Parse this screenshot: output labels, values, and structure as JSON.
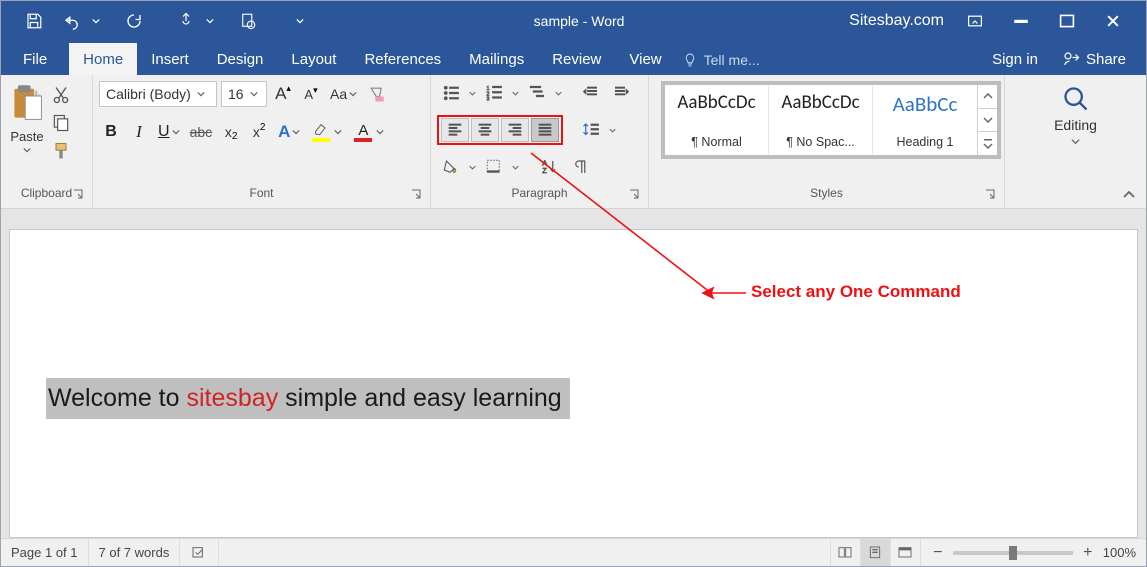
{
  "title": "sample - Word",
  "site": "Sitesbay.com",
  "tabs": {
    "file": "File",
    "home": "Home",
    "insert": "Insert",
    "design": "Design",
    "layout": "Layout",
    "references": "References",
    "mailings": "Mailings",
    "review": "Review",
    "view": "View",
    "tell": "Tell me...",
    "signin": "Sign in",
    "share": "Share"
  },
  "ribbon": {
    "clipboard": {
      "label": "Clipboard",
      "paste": "Paste"
    },
    "font": {
      "label": "Font",
      "name": "Calibri (Body)",
      "size": "16",
      "grow": "A",
      "shrink": "A",
      "case": "Aa",
      "bold": "B",
      "italic": "I",
      "underline": "U",
      "strike": "abc",
      "sub": "x",
      "sup": "x",
      "texteff": "A",
      "fontcolor": "A"
    },
    "paragraph": {
      "label": "Paragraph"
    },
    "styles": {
      "label": "Styles",
      "preview": "AaBbCcDc",
      "preview_h": "AaBbCc",
      "items": [
        "¶ Normal",
        "¶ No Spac...",
        "Heading 1"
      ]
    },
    "editing": {
      "label": "Editing"
    }
  },
  "document": {
    "text_pre": "Welcome to ",
    "text_red": "sitesbay",
    "text_post": " simple and easy learning"
  },
  "annotation": "Select any One Command",
  "status": {
    "page": "Page 1 of 1",
    "words": "7 of 7 words",
    "zoom": "100%"
  }
}
